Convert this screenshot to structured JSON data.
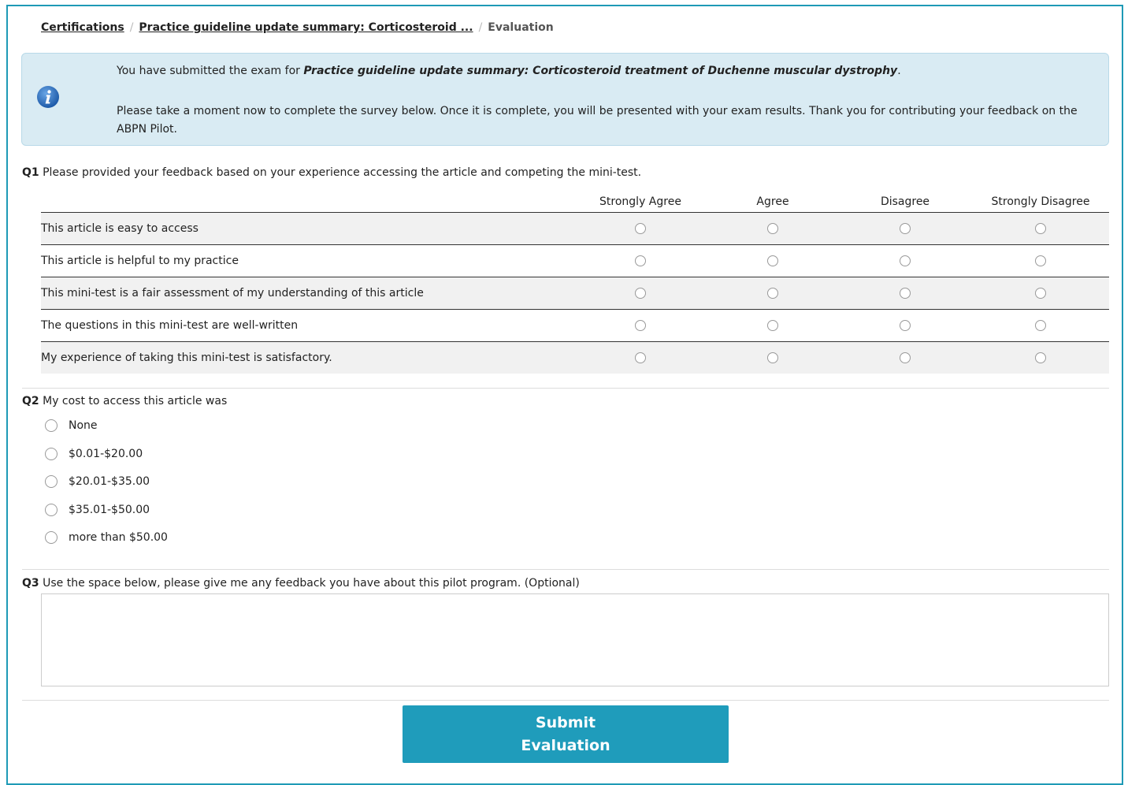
{
  "breadcrumb": {
    "item1": "Certifications",
    "item2": "Practice guideline update summary: Corticosteroid ...",
    "current": "Evaluation",
    "separator": "/"
  },
  "alert": {
    "prefix": "You have submitted the exam for ",
    "exam_title": "Practice guideline update summary: Corticosteroid treatment of Duchenne muscular dystrophy",
    "suffix": ".",
    "message": "Please take a moment now to complete the survey below. Once it is complete, you will be presented with your exam results. Thank you for contributing your feedback on the ABPN Pilot.",
    "icon": "info-icon"
  },
  "q1": {
    "number": "Q1",
    "text": "Please provided your feedback based on your experience accessing the article and competing the mini-test.",
    "columns": [
      "Strongly Agree",
      "Agree",
      "Disagree",
      "Strongly Disagree"
    ],
    "rows": [
      "This article is easy to access",
      "This article is helpful to my practice",
      "This mini-test is a fair assessment of my understanding of this article",
      "The questions in this mini-test are well-written",
      "My experience of taking this mini-test is satisfactory."
    ]
  },
  "q2": {
    "number": "Q2",
    "text": "My cost to access this article was",
    "options": [
      "None",
      "$0.01-$20.00",
      "$20.01-$35.00",
      "$35.01-$50.00",
      "more than $50.00"
    ]
  },
  "q3": {
    "number": "Q3",
    "text": "Use the space below, please give me any feedback you have about this pilot program. (Optional)",
    "value": ""
  },
  "submit": {
    "line1": "Submit",
    "line2": "Evaluation"
  },
  "colors": {
    "accent": "#1f9cbb",
    "alert_bg": "#d9ebf3",
    "info_icon": "#2c6fbb"
  }
}
